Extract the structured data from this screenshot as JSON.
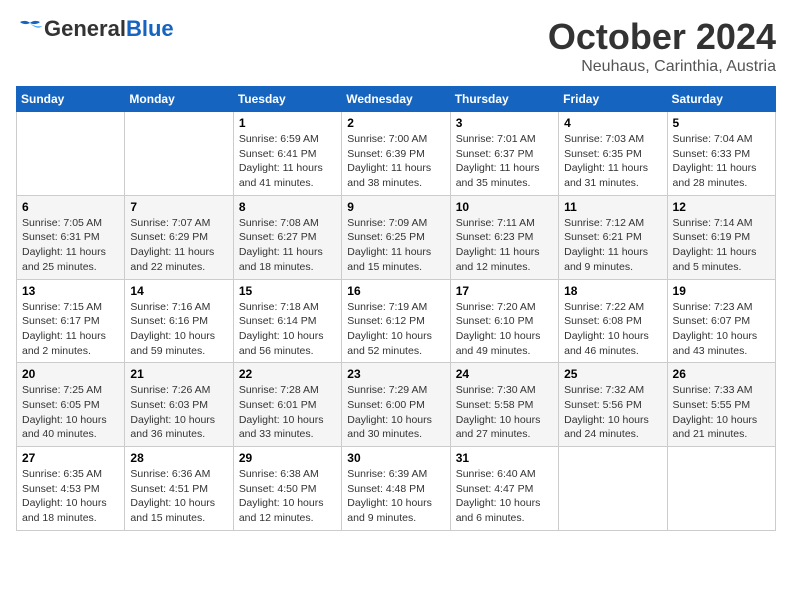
{
  "header": {
    "logo_general": "General",
    "logo_blue": "Blue",
    "month": "October 2024",
    "location": "Neuhaus, Carinthia, Austria"
  },
  "weekdays": [
    "Sunday",
    "Monday",
    "Tuesday",
    "Wednesday",
    "Thursday",
    "Friday",
    "Saturday"
  ],
  "weeks": [
    [
      {
        "day": "",
        "sunrise": "",
        "sunset": "",
        "daylight": ""
      },
      {
        "day": "",
        "sunrise": "",
        "sunset": "",
        "daylight": ""
      },
      {
        "day": "1",
        "sunrise": "Sunrise: 6:59 AM",
        "sunset": "Sunset: 6:41 PM",
        "daylight": "Daylight: 11 hours and 41 minutes."
      },
      {
        "day": "2",
        "sunrise": "Sunrise: 7:00 AM",
        "sunset": "Sunset: 6:39 PM",
        "daylight": "Daylight: 11 hours and 38 minutes."
      },
      {
        "day": "3",
        "sunrise": "Sunrise: 7:01 AM",
        "sunset": "Sunset: 6:37 PM",
        "daylight": "Daylight: 11 hours and 35 minutes."
      },
      {
        "day": "4",
        "sunrise": "Sunrise: 7:03 AM",
        "sunset": "Sunset: 6:35 PM",
        "daylight": "Daylight: 11 hours and 31 minutes."
      },
      {
        "day": "5",
        "sunrise": "Sunrise: 7:04 AM",
        "sunset": "Sunset: 6:33 PM",
        "daylight": "Daylight: 11 hours and 28 minutes."
      }
    ],
    [
      {
        "day": "6",
        "sunrise": "Sunrise: 7:05 AM",
        "sunset": "Sunset: 6:31 PM",
        "daylight": "Daylight: 11 hours and 25 minutes."
      },
      {
        "day": "7",
        "sunrise": "Sunrise: 7:07 AM",
        "sunset": "Sunset: 6:29 PM",
        "daylight": "Daylight: 11 hours and 22 minutes."
      },
      {
        "day": "8",
        "sunrise": "Sunrise: 7:08 AM",
        "sunset": "Sunset: 6:27 PM",
        "daylight": "Daylight: 11 hours and 18 minutes."
      },
      {
        "day": "9",
        "sunrise": "Sunrise: 7:09 AM",
        "sunset": "Sunset: 6:25 PM",
        "daylight": "Daylight: 11 hours and 15 minutes."
      },
      {
        "day": "10",
        "sunrise": "Sunrise: 7:11 AM",
        "sunset": "Sunset: 6:23 PM",
        "daylight": "Daylight: 11 hours and 12 minutes."
      },
      {
        "day": "11",
        "sunrise": "Sunrise: 7:12 AM",
        "sunset": "Sunset: 6:21 PM",
        "daylight": "Daylight: 11 hours and 9 minutes."
      },
      {
        "day": "12",
        "sunrise": "Sunrise: 7:14 AM",
        "sunset": "Sunset: 6:19 PM",
        "daylight": "Daylight: 11 hours and 5 minutes."
      }
    ],
    [
      {
        "day": "13",
        "sunrise": "Sunrise: 7:15 AM",
        "sunset": "Sunset: 6:17 PM",
        "daylight": "Daylight: 11 hours and 2 minutes."
      },
      {
        "day": "14",
        "sunrise": "Sunrise: 7:16 AM",
        "sunset": "Sunset: 6:16 PM",
        "daylight": "Daylight: 10 hours and 59 minutes."
      },
      {
        "day": "15",
        "sunrise": "Sunrise: 7:18 AM",
        "sunset": "Sunset: 6:14 PM",
        "daylight": "Daylight: 10 hours and 56 minutes."
      },
      {
        "day": "16",
        "sunrise": "Sunrise: 7:19 AM",
        "sunset": "Sunset: 6:12 PM",
        "daylight": "Daylight: 10 hours and 52 minutes."
      },
      {
        "day": "17",
        "sunrise": "Sunrise: 7:20 AM",
        "sunset": "Sunset: 6:10 PM",
        "daylight": "Daylight: 10 hours and 49 minutes."
      },
      {
        "day": "18",
        "sunrise": "Sunrise: 7:22 AM",
        "sunset": "Sunset: 6:08 PM",
        "daylight": "Daylight: 10 hours and 46 minutes."
      },
      {
        "day": "19",
        "sunrise": "Sunrise: 7:23 AM",
        "sunset": "Sunset: 6:07 PM",
        "daylight": "Daylight: 10 hours and 43 minutes."
      }
    ],
    [
      {
        "day": "20",
        "sunrise": "Sunrise: 7:25 AM",
        "sunset": "Sunset: 6:05 PM",
        "daylight": "Daylight: 10 hours and 40 minutes."
      },
      {
        "day": "21",
        "sunrise": "Sunrise: 7:26 AM",
        "sunset": "Sunset: 6:03 PM",
        "daylight": "Daylight: 10 hours and 36 minutes."
      },
      {
        "day": "22",
        "sunrise": "Sunrise: 7:28 AM",
        "sunset": "Sunset: 6:01 PM",
        "daylight": "Daylight: 10 hours and 33 minutes."
      },
      {
        "day": "23",
        "sunrise": "Sunrise: 7:29 AM",
        "sunset": "Sunset: 6:00 PM",
        "daylight": "Daylight: 10 hours and 30 minutes."
      },
      {
        "day": "24",
        "sunrise": "Sunrise: 7:30 AM",
        "sunset": "Sunset: 5:58 PM",
        "daylight": "Daylight: 10 hours and 27 minutes."
      },
      {
        "day": "25",
        "sunrise": "Sunrise: 7:32 AM",
        "sunset": "Sunset: 5:56 PM",
        "daylight": "Daylight: 10 hours and 24 minutes."
      },
      {
        "day": "26",
        "sunrise": "Sunrise: 7:33 AM",
        "sunset": "Sunset: 5:55 PM",
        "daylight": "Daylight: 10 hours and 21 minutes."
      }
    ],
    [
      {
        "day": "27",
        "sunrise": "Sunrise: 6:35 AM",
        "sunset": "Sunset: 4:53 PM",
        "daylight": "Daylight: 10 hours and 18 minutes."
      },
      {
        "day": "28",
        "sunrise": "Sunrise: 6:36 AM",
        "sunset": "Sunset: 4:51 PM",
        "daylight": "Daylight: 10 hours and 15 minutes."
      },
      {
        "day": "29",
        "sunrise": "Sunrise: 6:38 AM",
        "sunset": "Sunset: 4:50 PM",
        "daylight": "Daylight: 10 hours and 12 minutes."
      },
      {
        "day": "30",
        "sunrise": "Sunrise: 6:39 AM",
        "sunset": "Sunset: 4:48 PM",
        "daylight": "Daylight: 10 hours and 9 minutes."
      },
      {
        "day": "31",
        "sunrise": "Sunrise: 6:40 AM",
        "sunset": "Sunset: 4:47 PM",
        "daylight": "Daylight: 10 hours and 6 minutes."
      },
      {
        "day": "",
        "sunrise": "",
        "sunset": "",
        "daylight": ""
      },
      {
        "day": "",
        "sunrise": "",
        "sunset": "",
        "daylight": ""
      }
    ]
  ]
}
